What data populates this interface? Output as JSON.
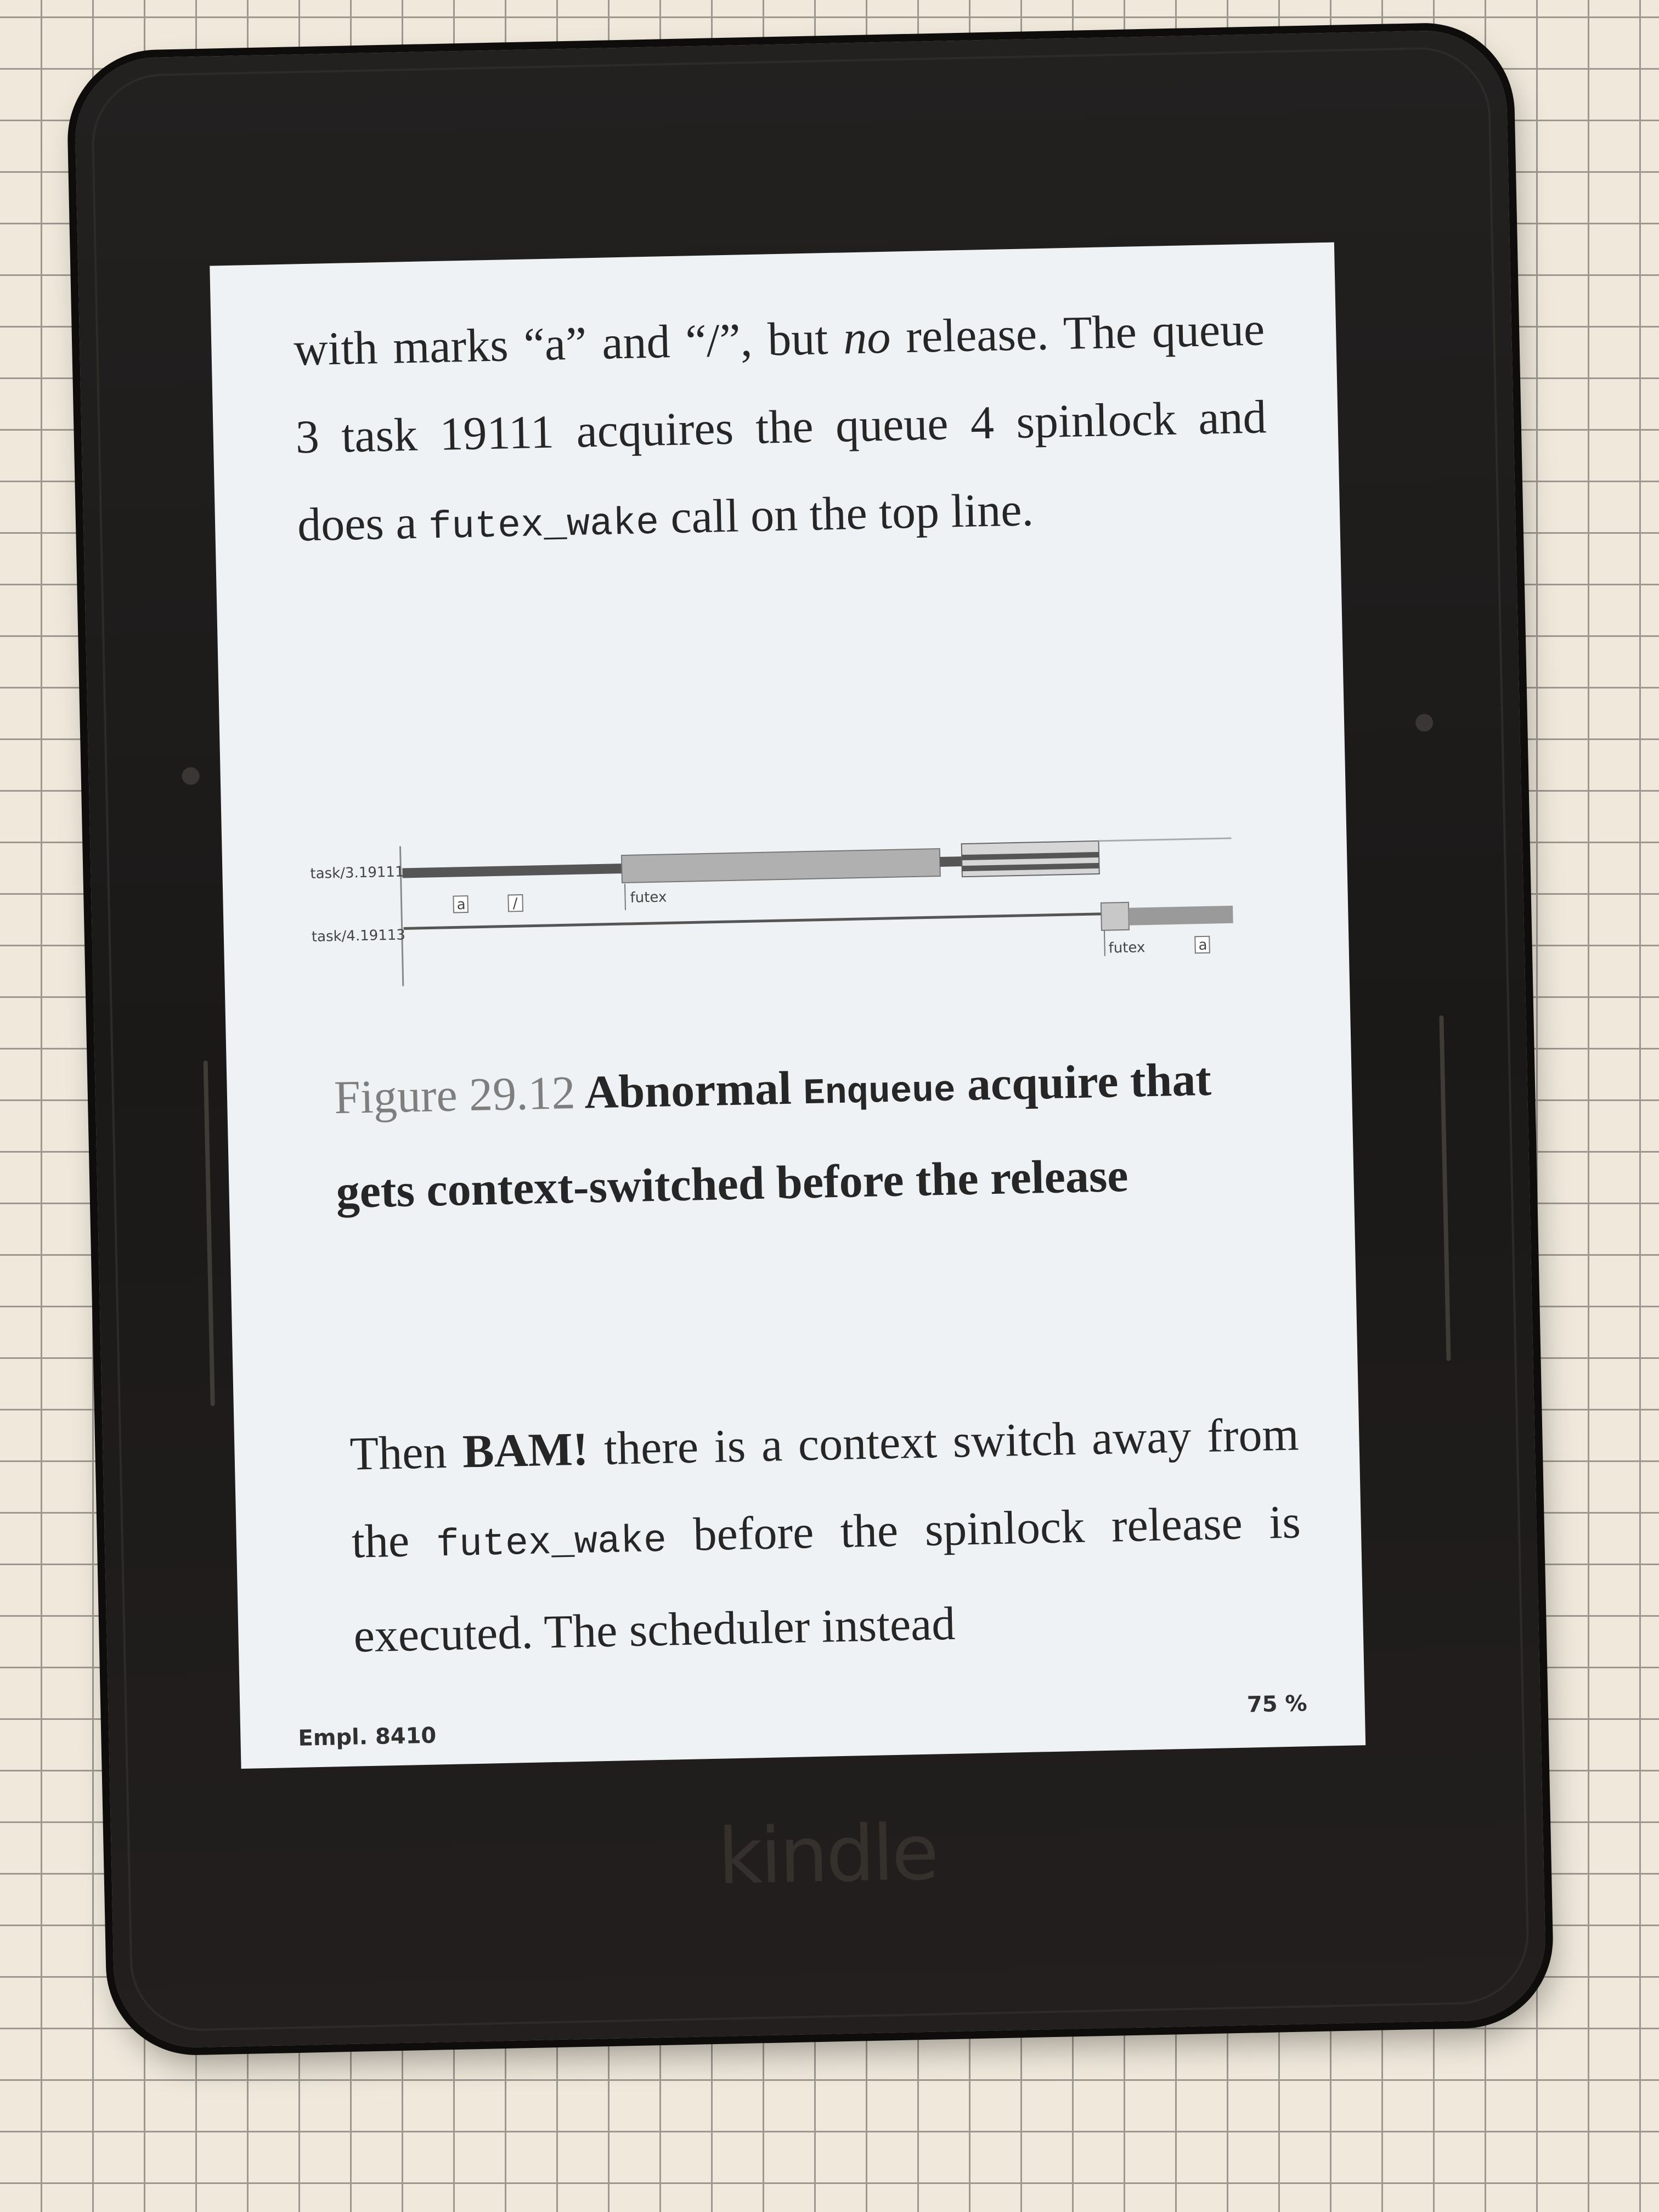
{
  "device": {
    "brand": "kindle"
  },
  "page": {
    "para1": {
      "t1": "with marks “a” and “/”, but ",
      "t2": "no",
      "t3": " release. The queue 3 task 19111 acquires the queue 4 spinlock and does a ",
      "code": "futex_wake",
      "t4": " call on the top line."
    },
    "figure": {
      "row1_label": "task/3.19111",
      "row2_label": "task/4.19113",
      "mark_a": "a",
      "mark_slash": "/",
      "futex1": "futex",
      "futex2": "futex",
      "mark_a2": "a"
    },
    "caption": {
      "number": "Figure 29.12",
      "t1": "Abnormal",
      "code": "Enqueue",
      "t2": "acquire that gets context-switched before the release"
    },
    "para2": {
      "t1": "Then ",
      "bold": "BAM!",
      "t2": " there is a context switch away from the ",
      "code": "futex_wake",
      "t3": " before the spinlock release is executed. The scheduler instead"
    },
    "status": {
      "location": "Empl. 8410",
      "percent": "75 %"
    }
  }
}
